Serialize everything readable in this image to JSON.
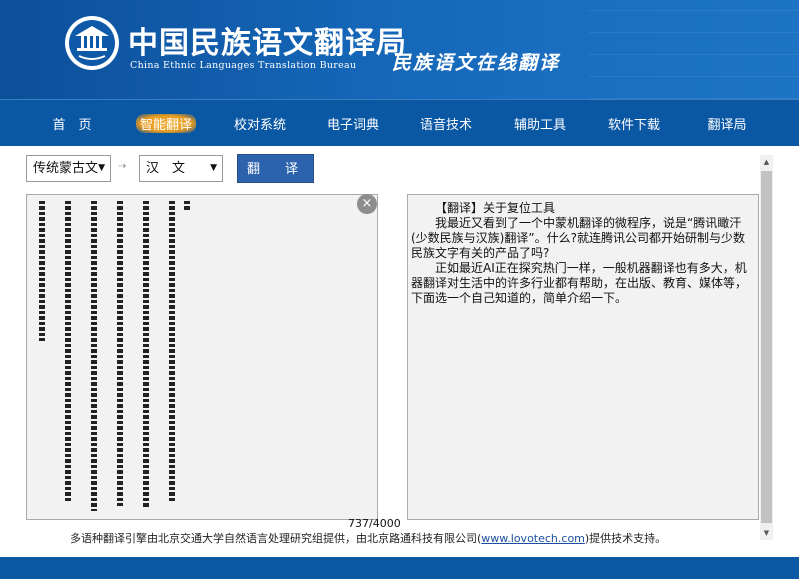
{
  "header": {
    "title": "中国民族语文翻译局",
    "subtitle": "China Ethnic Languages Translation Bureau",
    "slogan": "民族语文在线翻译"
  },
  "nav": {
    "items": [
      {
        "label": "首　页"
      },
      {
        "label": "智能翻译",
        "active": true
      },
      {
        "label": "校对系统"
      },
      {
        "label": "电子词典"
      },
      {
        "label": "语音技术"
      },
      {
        "label": "辅助工具"
      },
      {
        "label": "软件下载"
      },
      {
        "label": "翻译局"
      }
    ]
  },
  "translator": {
    "source_lang": "传统蒙古文",
    "target_lang": "汉　文",
    "translate_label": "翻　译",
    "clear_label": "×",
    "char_count": "737/4000"
  },
  "target_text": {
    "title_line": "【翻译】关于复位工具",
    "paragraph1": "我最近又看到了一个中蒙机翻译的微程序，说是“腾讯瞰汗(少数民族与汉族)翻译”。什么?就连腾讯公司都开始研制与少数民族文字有关的产品了吗?",
    "paragraph2": "正如最近AI正在探究热门一样，一般机器翻译也有多大，机器翻译对生活中的许多行业都有帮助，在出版、教育、媒体等，下面选一个自己知道的，简单介绍一下。"
  },
  "footer": {
    "note_prefix": "多语种翻译引擎由北京交通大学自然语言处理研究组提供，由北京路通科技有限公司(",
    "link": "www.lovotech.com",
    "note_suffix": ")提供技术支持。"
  },
  "colors": {
    "banner_blue": "#1566b7",
    "nav_blue": "#0a57a4",
    "button_blue": "#2d63ac",
    "active_highlight": "#e69a1f"
  }
}
